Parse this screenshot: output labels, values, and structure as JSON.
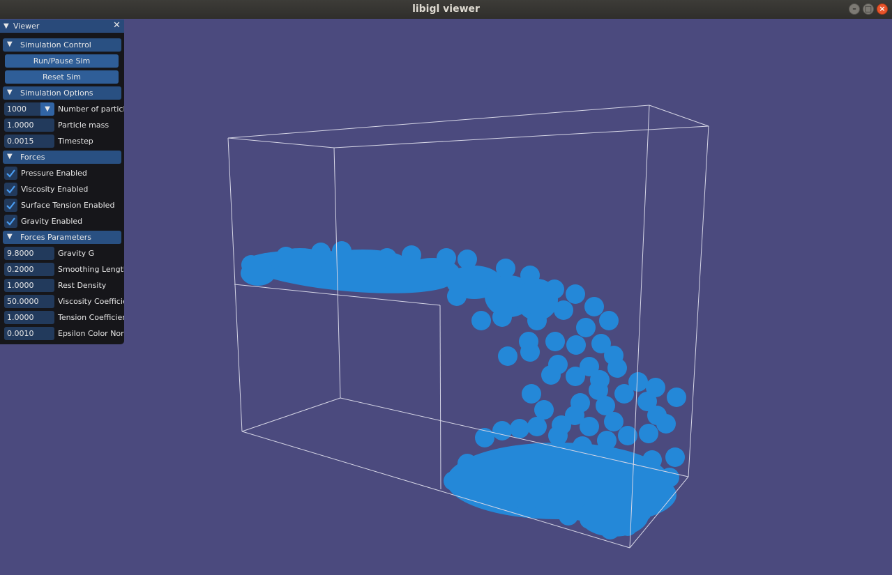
{
  "window": {
    "title": "libigl viewer",
    "buttons": {
      "minimize": "–",
      "maximize": "□",
      "close": "×"
    }
  },
  "viewer_panel": {
    "title": "Viewer",
    "close_symbol": "✕",
    "sections": {
      "simulation_control": "Simulation Control",
      "simulation_options": "Simulation Options",
      "forces": "Forces",
      "forces_parameters": "Forces Parameters"
    },
    "buttons": {
      "run_pause": "Run/Pause Sim",
      "reset": "Reset Sim"
    },
    "options": {
      "num_particles": {
        "value": "1000",
        "label": "Number of particles"
      },
      "particle_mass": {
        "value": "1.0000",
        "label": "Particle mass"
      },
      "timestep": {
        "value": "0.0015",
        "label": "Timestep"
      }
    },
    "forces": {
      "pressure": {
        "label": "Pressure Enabled",
        "checked": true
      },
      "viscosity": {
        "label": "Viscosity Enabled",
        "checked": true
      },
      "surface_tension": {
        "label": "Surface Tension Enabled",
        "checked": true
      },
      "gravity": {
        "label": "Gravity Enabled",
        "checked": true
      }
    },
    "parameters": {
      "gravity_g": {
        "value": "9.8000",
        "label": "Gravity G"
      },
      "smoothing_length": {
        "value": "0.2000",
        "label": "Smoothing Length"
      },
      "rest_density": {
        "value": "1.0000",
        "label": "Rest Density"
      },
      "viscosity_coefficient": {
        "value": "50.0000",
        "label": "Viscosity Coefficient"
      },
      "tension_coefficient": {
        "value": "1.0000",
        "label": "Tension Coefficient"
      },
      "epsilon_color_norm": {
        "value": "0.0010",
        "label": "Epsilon Color Norm"
      }
    }
  },
  "viewport": {
    "background_color": "#4b4a7e",
    "particle_color": "#2488d8",
    "box_line_color": "#d6d6e6"
  }
}
